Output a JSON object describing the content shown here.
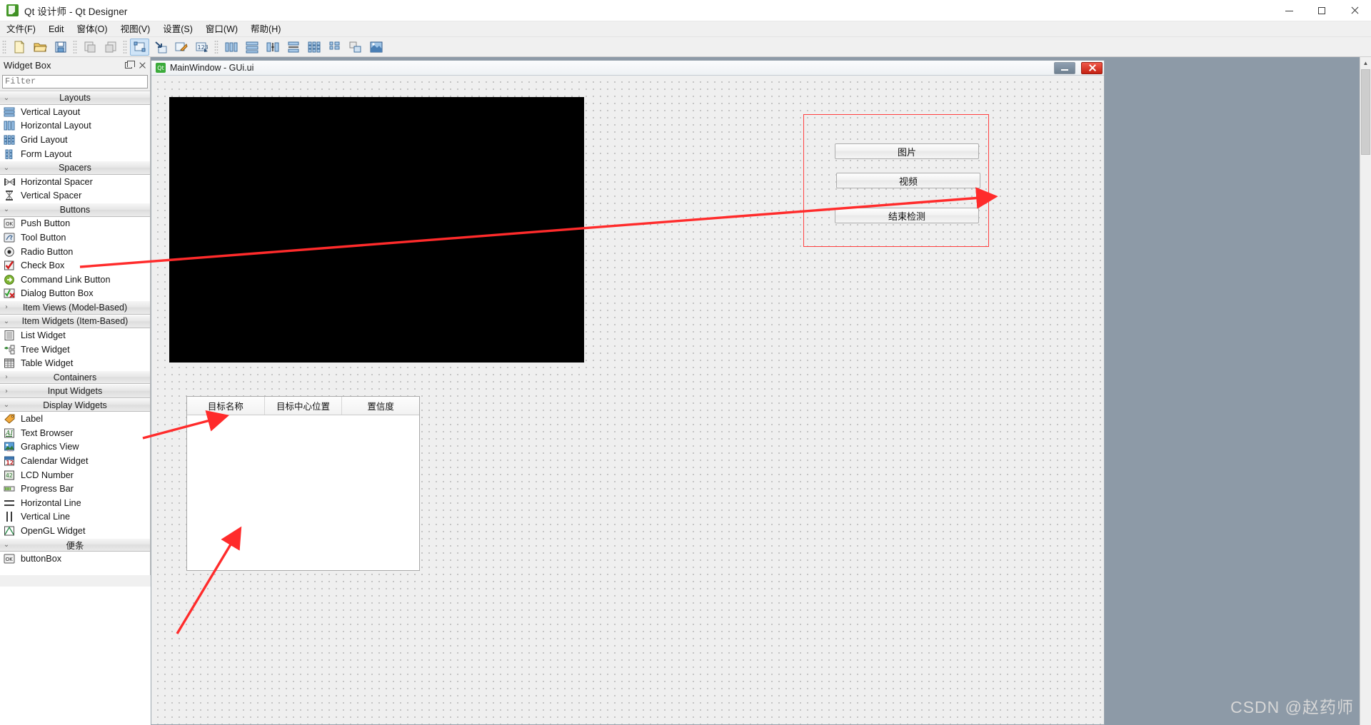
{
  "window": {
    "title": "Qt 设计师 - Qt Designer",
    "icon": "qt-designer-icon",
    "minimize": "minimize-icon",
    "maximize": "maximize-icon",
    "close": "close-icon"
  },
  "menubar": {
    "items": [
      {
        "label": "文件(F)"
      },
      {
        "label": "Edit"
      },
      {
        "label": "窗体(O)"
      },
      {
        "label": "视图(V)"
      },
      {
        "label": "设置(S)"
      },
      {
        "label": "窗口(W)"
      },
      {
        "label": "帮助(H)"
      }
    ]
  },
  "toolbar": {
    "groups": [
      {
        "buttons": [
          {
            "name": "new-form-icon",
            "label": "New"
          },
          {
            "name": "open-form-icon",
            "label": "Open"
          },
          {
            "name": "save-form-icon",
            "label": "Save"
          }
        ]
      },
      {
        "buttons": [
          {
            "name": "undo-icon",
            "label": "Undo"
          },
          {
            "name": "redo-icon",
            "label": "Redo"
          }
        ]
      },
      {
        "buttons": [
          {
            "name": "edit-widgets-icon",
            "label": "Edit Widgets",
            "active": true
          },
          {
            "name": "edit-signals-slots-icon",
            "label": "Edit Signals/Slots"
          },
          {
            "name": "edit-buddies-icon",
            "label": "Edit Buddies"
          },
          {
            "name": "edit-tab-order-icon",
            "label": "Edit Tab Order"
          }
        ]
      },
      {
        "buttons": [
          {
            "name": "layout-horizontally-icon",
            "label": "Lay Out Horizontally"
          },
          {
            "name": "layout-vertically-icon",
            "label": "Lay Out Vertically"
          },
          {
            "name": "layout-splitter-horizontal-icon",
            "label": "Lay Out Horizontally in Splitter"
          },
          {
            "name": "layout-splitter-vertical-icon",
            "label": "Lay Out Vertically in Splitter"
          },
          {
            "name": "layout-grid-icon",
            "label": "Lay Out in a Grid"
          },
          {
            "name": "layout-form-icon",
            "label": "Lay Out in a Form Layout"
          },
          {
            "name": "break-layout-icon",
            "label": "Break Layout"
          },
          {
            "name": "adjust-size-icon",
            "label": "Adjust Size"
          }
        ]
      }
    ]
  },
  "widget_box": {
    "title": "Widget Box",
    "float_icon": "float-dock-icon",
    "close_icon": "close-dock-icon",
    "filter_placeholder": "Filter",
    "filter_value": "",
    "categories": [
      {
        "label": "Layouts",
        "expanded": true,
        "chevron": "chevron-down-icon",
        "items": [
          {
            "label": "Vertical Layout",
            "icon": "vertical-layout-icon"
          },
          {
            "label": "Horizontal Layout",
            "icon": "horizontal-layout-icon"
          },
          {
            "label": "Grid Layout",
            "icon": "grid-layout-icon"
          },
          {
            "label": "Form Layout",
            "icon": "form-layout-icon"
          }
        ]
      },
      {
        "label": "Spacers",
        "expanded": true,
        "chevron": "chevron-down-icon",
        "items": [
          {
            "label": "Horizontal Spacer",
            "icon": "horizontal-spacer-icon"
          },
          {
            "label": "Vertical Spacer",
            "icon": "vertical-spacer-icon"
          }
        ]
      },
      {
        "label": "Buttons",
        "expanded": true,
        "chevron": "chevron-down-icon",
        "items": [
          {
            "label": "Push Button",
            "icon": "push-button-icon"
          },
          {
            "label": "Tool Button",
            "icon": "tool-button-icon"
          },
          {
            "label": "Radio Button",
            "icon": "radio-button-icon"
          },
          {
            "label": "Check Box",
            "icon": "check-box-icon"
          },
          {
            "label": "Command Link Button",
            "icon": "command-link-button-icon"
          },
          {
            "label": "Dialog Button Box",
            "icon": "dialog-button-box-icon"
          }
        ]
      },
      {
        "label": "Item Views (Model-Based)",
        "expanded": false,
        "chevron": "chevron-right-icon",
        "items": []
      },
      {
        "label": "Item Widgets (Item-Based)",
        "expanded": true,
        "chevron": "chevron-down-icon",
        "items": [
          {
            "label": "List Widget",
            "icon": "list-widget-icon"
          },
          {
            "label": "Tree Widget",
            "icon": "tree-widget-icon"
          },
          {
            "label": "Table Widget",
            "icon": "table-widget-icon"
          }
        ]
      },
      {
        "label": "Containers",
        "expanded": false,
        "chevron": "chevron-right-icon",
        "items": []
      },
      {
        "label": "Input Widgets",
        "expanded": false,
        "chevron": "chevron-right-icon",
        "items": []
      },
      {
        "label": "Display Widgets",
        "expanded": true,
        "chevron": "chevron-down-icon",
        "items": [
          {
            "label": "Label",
            "icon": "label-icon"
          },
          {
            "label": "Text Browser",
            "icon": "text-browser-icon"
          },
          {
            "label": "Graphics View",
            "icon": "graphics-view-icon"
          },
          {
            "label": "Calendar Widget",
            "icon": "calendar-widget-icon"
          },
          {
            "label": "LCD Number",
            "icon": "lcd-number-icon"
          },
          {
            "label": "Progress Bar",
            "icon": "progress-bar-icon"
          },
          {
            "label": "Horizontal Line",
            "icon": "horizontal-line-icon"
          },
          {
            "label": "Vertical Line",
            "icon": "vertical-line-icon"
          },
          {
            "label": "OpenGL Widget",
            "icon": "opengl-widget-icon"
          }
        ]
      },
      {
        "label": "便条",
        "expanded": true,
        "chevron": "chevron-down-icon",
        "items": [
          {
            "label": "buttonBox",
            "icon": "button-box-icon"
          }
        ]
      }
    ]
  },
  "form_window": {
    "title": "MainWindow - GUi.ui",
    "icon": "qt-form-icon",
    "minimize": "form-minimize-icon",
    "close": "form-close-icon",
    "video_preview": {
      "name": "video-preview-area"
    },
    "group_box": {
      "border_color": "#ff4040",
      "buttons": [
        {
          "label": "图片"
        },
        {
          "label": "视频"
        },
        {
          "label": "结束检测"
        }
      ]
    },
    "table": {
      "headers": [
        "目标名称",
        "目标中心位置",
        "置信度"
      ],
      "rows": []
    }
  },
  "annotations": {
    "arrow_color": "#ff2b2b",
    "arrows": [
      {
        "name": "arrow-push-button-to-group",
        "from": "Push Button",
        "to": "group-box"
      },
      {
        "name": "arrow-table-widget-to-table",
        "from": "Table Widget",
        "to": "table-widget"
      },
      {
        "name": "arrow-display-widgets-to-video",
        "from": "Display Widgets",
        "to": "video-preview-area"
      }
    ]
  },
  "watermark": {
    "text": "CSDN @赵药师"
  }
}
